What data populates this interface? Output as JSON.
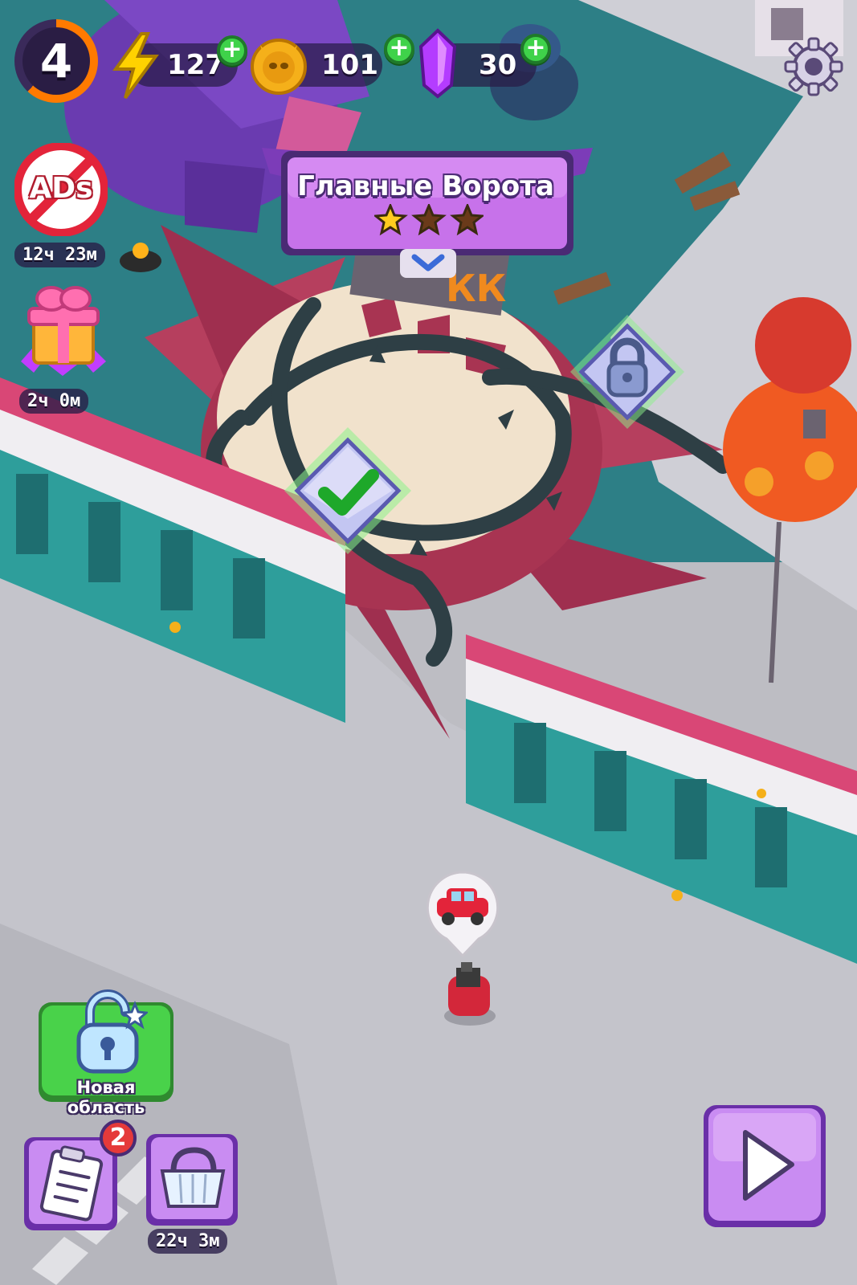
{
  "hud": {
    "level": "4",
    "energy": "127",
    "coins": "101",
    "gems": "30"
  },
  "location": {
    "title": "Главные Ворота",
    "stars_earned": 1,
    "stars_total": 3
  },
  "left_panel": {
    "no_ads_label": "ADs",
    "no_ads_timer": "12ч 23м",
    "gift_timer": "2ч 0м"
  },
  "bottom": {
    "new_area_label": "Новая область",
    "tasks_badge": "2",
    "shop_timer": "22ч 3м"
  },
  "colors": {
    "energy": "#ffd200",
    "coin": "#f5b01a",
    "gem": "#b43cff",
    "plus": "#3fd24a",
    "banner": "#a24fd8",
    "play_button": "#c98cf2",
    "new_area_button": "#49d24a"
  },
  "icons": [
    "settings-gear-icon",
    "energy-bolt-icon",
    "coin-skull-icon",
    "gem-crystal-icon",
    "no-ads-icon",
    "gift-box-icon",
    "unlock-icon",
    "tasks-clipboard-icon",
    "shop-basket-icon",
    "play-icon",
    "checkmark-icon",
    "padlock-icon",
    "car-icon",
    "chevron-down-icon"
  ]
}
